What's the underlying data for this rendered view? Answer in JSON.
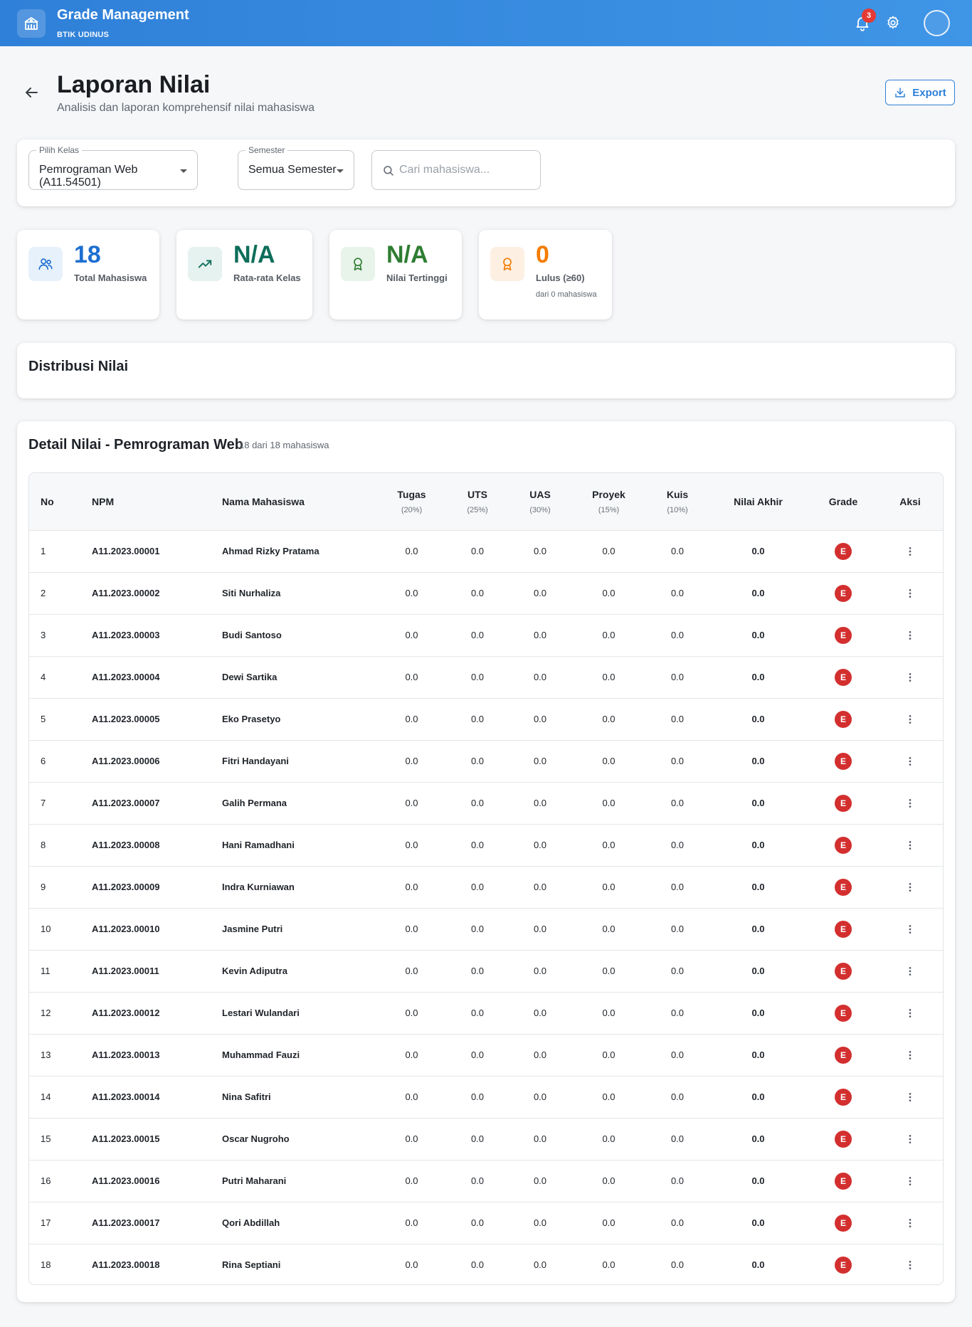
{
  "header": {
    "title": "Grade Management",
    "subtitle": "BTIK UDINUS",
    "notification_count": "3"
  },
  "page": {
    "title": "Laporan Nilai",
    "subtitle": "Analisis dan laporan komprehensif nilai mahasiswa",
    "export_label": "Export"
  },
  "filters": {
    "class_legend": "Pilih Kelas",
    "class_value": "Pemrograman Web (A11.54501)",
    "semester_legend": "Semester",
    "semester_value": "Semua Semester",
    "search_placeholder": "Cari mahasiswa..."
  },
  "stats": [
    {
      "value": "18",
      "label": "Total Mahasiswa",
      "color": "#1e6fd0"
    },
    {
      "value": "N/A",
      "label": "Rata-rata Kelas",
      "color": "#0d6e5a"
    },
    {
      "value": "N/A",
      "label": "Nilai Tertinggi",
      "color": "#2e7d32"
    },
    {
      "value": "0",
      "label": "Lulus (≥60)",
      "note": "dari 0 mahasiswa",
      "color": "#f57c00"
    }
  ],
  "distribution": {
    "title": "Distribusi Nilai"
  },
  "detail": {
    "title": "Detail Nilai - Pemrograman Web",
    "count": "18 dari 18 mahasiswa",
    "columns": {
      "no": "No",
      "npm": "NPM",
      "name": "Nama Mahasiswa",
      "tugas": "Tugas",
      "tugas_w": "(20%)",
      "uts": "UTS",
      "uts_w": "(25%)",
      "uas": "UAS",
      "uas_w": "(30%)",
      "proyek": "Proyek",
      "proyek_w": "(15%)",
      "kuis": "Kuis",
      "kuis_w": "(10%)",
      "final": "Nilai Akhir",
      "grade": "Grade",
      "action": "Aksi"
    },
    "rows": [
      {
        "no": "1",
        "npm": "A11.2023.00001",
        "name": "Ahmad Rizky Pratama",
        "tugas": "0.0",
        "uts": "0.0",
        "uas": "0.0",
        "proyek": "0.0",
        "kuis": "0.0",
        "final": "0.0",
        "grade": "E"
      },
      {
        "no": "2",
        "npm": "A11.2023.00002",
        "name": "Siti Nurhaliza",
        "tugas": "0.0",
        "uts": "0.0",
        "uas": "0.0",
        "proyek": "0.0",
        "kuis": "0.0",
        "final": "0.0",
        "grade": "E"
      },
      {
        "no": "3",
        "npm": "A11.2023.00003",
        "name": "Budi Santoso",
        "tugas": "0.0",
        "uts": "0.0",
        "uas": "0.0",
        "proyek": "0.0",
        "kuis": "0.0",
        "final": "0.0",
        "grade": "E"
      },
      {
        "no": "4",
        "npm": "A11.2023.00004",
        "name": "Dewi Sartika",
        "tugas": "0.0",
        "uts": "0.0",
        "uas": "0.0",
        "proyek": "0.0",
        "kuis": "0.0",
        "final": "0.0",
        "grade": "E"
      },
      {
        "no": "5",
        "npm": "A11.2023.00005",
        "name": "Eko Prasetyo",
        "tugas": "0.0",
        "uts": "0.0",
        "uas": "0.0",
        "proyek": "0.0",
        "kuis": "0.0",
        "final": "0.0",
        "grade": "E"
      },
      {
        "no": "6",
        "npm": "A11.2023.00006",
        "name": "Fitri Handayani",
        "tugas": "0.0",
        "uts": "0.0",
        "uas": "0.0",
        "proyek": "0.0",
        "kuis": "0.0",
        "final": "0.0",
        "grade": "E"
      },
      {
        "no": "7",
        "npm": "A11.2023.00007",
        "name": "Galih Permana",
        "tugas": "0.0",
        "uts": "0.0",
        "uas": "0.0",
        "proyek": "0.0",
        "kuis": "0.0",
        "final": "0.0",
        "grade": "E"
      },
      {
        "no": "8",
        "npm": "A11.2023.00008",
        "name": "Hani Ramadhani",
        "tugas": "0.0",
        "uts": "0.0",
        "uas": "0.0",
        "proyek": "0.0",
        "kuis": "0.0",
        "final": "0.0",
        "grade": "E"
      },
      {
        "no": "9",
        "npm": "A11.2023.00009",
        "name": "Indra Kurniawan",
        "tugas": "0.0",
        "uts": "0.0",
        "uas": "0.0",
        "proyek": "0.0",
        "kuis": "0.0",
        "final": "0.0",
        "grade": "E"
      },
      {
        "no": "10",
        "npm": "A11.2023.00010",
        "name": "Jasmine Putri",
        "tugas": "0.0",
        "uts": "0.0",
        "uas": "0.0",
        "proyek": "0.0",
        "kuis": "0.0",
        "final": "0.0",
        "grade": "E"
      },
      {
        "no": "11",
        "npm": "A11.2023.00011",
        "name": "Kevin Adiputra",
        "tugas": "0.0",
        "uts": "0.0",
        "uas": "0.0",
        "proyek": "0.0",
        "kuis": "0.0",
        "final": "0.0",
        "grade": "E"
      },
      {
        "no": "12",
        "npm": "A11.2023.00012",
        "name": "Lestari Wulandari",
        "tugas": "0.0",
        "uts": "0.0",
        "uas": "0.0",
        "proyek": "0.0",
        "kuis": "0.0",
        "final": "0.0",
        "grade": "E"
      },
      {
        "no": "13",
        "npm": "A11.2023.00013",
        "name": "Muhammad Fauzi",
        "tugas": "0.0",
        "uts": "0.0",
        "uas": "0.0",
        "proyek": "0.0",
        "kuis": "0.0",
        "final": "0.0",
        "grade": "E"
      },
      {
        "no": "14",
        "npm": "A11.2023.00014",
        "name": "Nina Safitri",
        "tugas": "0.0",
        "uts": "0.0",
        "uas": "0.0",
        "proyek": "0.0",
        "kuis": "0.0",
        "final": "0.0",
        "grade": "E"
      },
      {
        "no": "15",
        "npm": "A11.2023.00015",
        "name": "Oscar Nugroho",
        "tugas": "0.0",
        "uts": "0.0",
        "uas": "0.0",
        "proyek": "0.0",
        "kuis": "0.0",
        "final": "0.0",
        "grade": "E"
      },
      {
        "no": "16",
        "npm": "A11.2023.00016",
        "name": "Putri Maharani",
        "tugas": "0.0",
        "uts": "0.0",
        "uas": "0.0",
        "proyek": "0.0",
        "kuis": "0.0",
        "final": "0.0",
        "grade": "E"
      },
      {
        "no": "17",
        "npm": "A11.2023.00017",
        "name": "Qori Abdillah",
        "tugas": "0.0",
        "uts": "0.0",
        "uas": "0.0",
        "proyek": "0.0",
        "kuis": "0.0",
        "final": "0.0",
        "grade": "E"
      },
      {
        "no": "18",
        "npm": "A11.2023.00018",
        "name": "Rina Septiani",
        "tugas": "0.0",
        "uts": "0.0",
        "uas": "0.0",
        "proyek": "0.0",
        "kuis": "0.0",
        "final": "0.0",
        "grade": "E"
      }
    ]
  }
}
